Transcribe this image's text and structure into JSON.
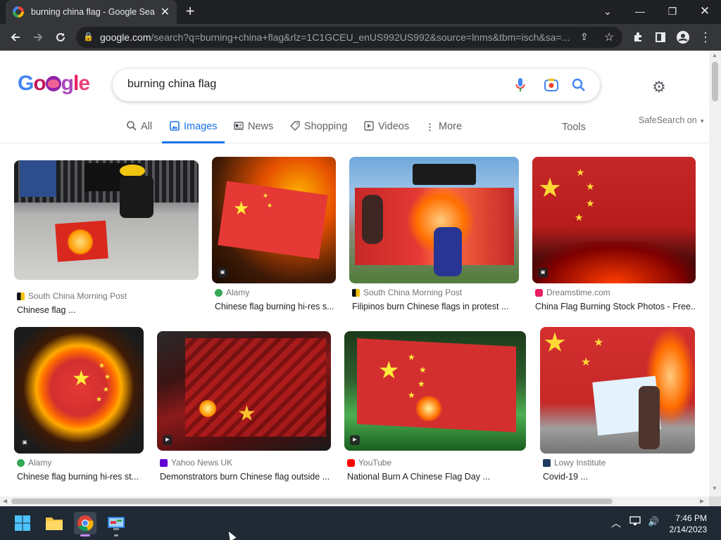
{
  "browser": {
    "tab_title": "burning china flag - Google Sear",
    "url_host": "google.com",
    "url_rest": "/search?q=burning+china+flag&rlz=1C1GCEU_enUS992US992&source=lnms&tbm=isch&sa=..."
  },
  "search": {
    "logo": "Google",
    "query": "burning china flag",
    "tabs": [
      {
        "label": "All",
        "icon": "search-icon"
      },
      {
        "label": "Images",
        "icon": "image-icon"
      },
      {
        "label": "News",
        "icon": "news-icon"
      },
      {
        "label": "Shopping",
        "icon": "tag-icon"
      },
      {
        "label": "Videos",
        "icon": "play-icon"
      },
      {
        "label": "More",
        "icon": "kebab-icon"
      }
    ],
    "tools": "Tools",
    "safesearch": "SafeSearch on"
  },
  "results": [
    {
      "source": "South China Morning Post",
      "title": "Chinese flag ...",
      "fav_color": "#f4c20d"
    },
    {
      "source": "Alamy",
      "title": "Chinese flag burning hi-res s...",
      "fav_color": "#34a853"
    },
    {
      "source": "South China Morning Post",
      "title": "Filipinos burn Chinese flags in protest ...",
      "fav_color": "#f4c20d"
    },
    {
      "source": "Dreamstime.com",
      "title": "China Flag Burning Stock Photos - Free...",
      "fav_color": "#e91e63"
    },
    {
      "source": "Alamy",
      "title": "Chinese flag burning hi-res st...",
      "fav_color": "#34a853"
    },
    {
      "source": "Yahoo News UK",
      "title": "Demonstrators burn Chinese flag outside ...",
      "fav_color": "#6001d2"
    },
    {
      "source": "YouTube",
      "title": "National Burn A Chinese Flag Day ...",
      "fav_color": "#ff0000"
    },
    {
      "source": "Lowy Institute",
      "title": "Covid-19 ...",
      "fav_color": "#1e3a5f"
    }
  ],
  "taskbar": {
    "time": "7:46 PM",
    "date": "2/14/2023"
  }
}
